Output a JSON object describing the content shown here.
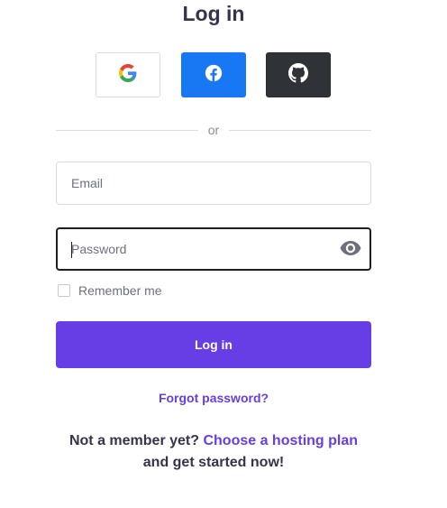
{
  "page": {
    "title": "Log in",
    "divider_text": "or",
    "email": {
      "placeholder": "Email",
      "value": ""
    },
    "password": {
      "placeholder": "Password",
      "value": ""
    },
    "remember_label": "Remember me",
    "remember_checked": false,
    "login_button": "Log in",
    "forgot_link": "Forgot password?",
    "signup": {
      "prefix": "Not a member yet?",
      "link": "Choose a hosting plan",
      "suffix": "and get started now!"
    }
  },
  "social": [
    {
      "name": "Google",
      "icon": "google-icon",
      "color": "#ffffff"
    },
    {
      "name": "Facebook",
      "icon": "facebook-icon",
      "color": "#1877f2"
    },
    {
      "name": "GitHub",
      "icon": "github-icon",
      "color": "#2f3237"
    }
  ],
  "colors": {
    "accent": "#673de6",
    "text": "#36344d",
    "muted": "#6d7081"
  }
}
